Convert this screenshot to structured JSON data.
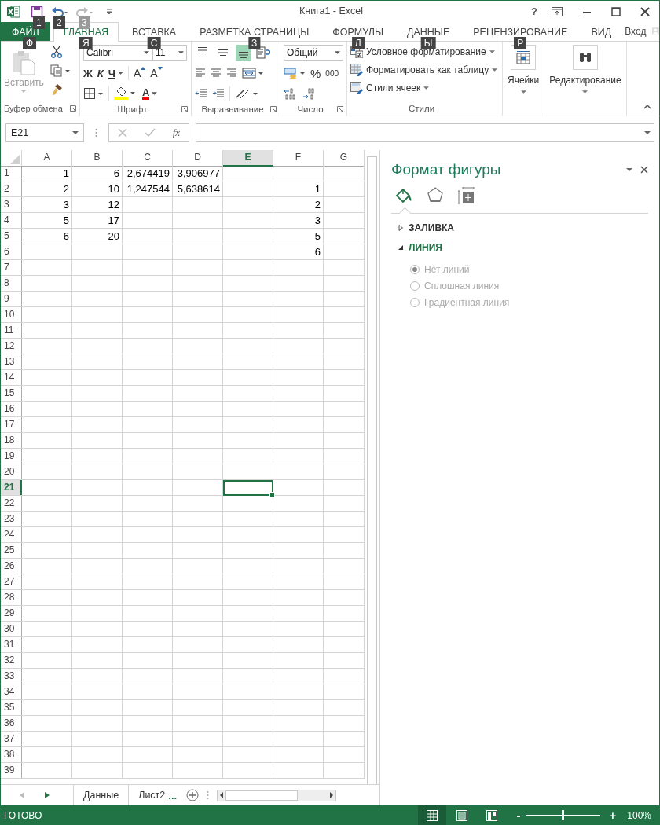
{
  "title_bar": {
    "title": "Книга1 - Excel",
    "help": "?",
    "quick_access": [
      {
        "kind": "save",
        "key_tip": "1",
        "disabled": false
      },
      {
        "kind": "undo",
        "key_tip": "2",
        "disabled": false
      },
      {
        "kind": "redo",
        "key_tip": "3",
        "disabled": true
      }
    ]
  },
  "tabs": [
    {
      "label": "ФАЙЛ",
      "kind": "file",
      "key_tip": "Ф",
      "selected": false
    },
    {
      "label": "ГЛАВНАЯ",
      "kind": "tab",
      "key_tip": "Я",
      "selected": true
    },
    {
      "label": "ВСТАВКА",
      "kind": "tab",
      "key_tip": "С",
      "selected": false
    },
    {
      "label": "РАЗМЕТКА СТРАНИЦЫ",
      "kind": "tab",
      "key_tip": "З",
      "selected": false
    },
    {
      "label": "ФОРМУЛЫ",
      "kind": "tab",
      "key_tip": "Л",
      "selected": false
    },
    {
      "label": "ДАННЫЕ",
      "kind": "tab",
      "key_tip": "Ы",
      "selected": false
    },
    {
      "label": "РЕЦЕНЗИРОВАНИЕ",
      "kind": "tab",
      "key_tip": "Р",
      "selected": false
    },
    {
      "label": "ВИД",
      "kind": "tab",
      "selected": false
    }
  ],
  "account": {
    "label": "Вход"
  },
  "ribbon": {
    "clipboard": {
      "label": "Буфер обмена",
      "paste": "Вставить",
      "paste_disabled": true
    },
    "font": {
      "label": "Шрифт",
      "name": "Calibri",
      "size": "11",
      "bold": "Ж",
      "italic": "К",
      "underline": "Ч",
      "grow": "A",
      "shrink": "A",
      "color_glyph": "A"
    },
    "alignment": {
      "label": "Выравнивание",
      "vertical": [
        {
          "selected": false
        },
        {
          "selected": false
        },
        {
          "selected": true
        }
      ]
    },
    "number": {
      "label": "Число",
      "format": "Общий",
      "percent": "%",
      "thousands": "000"
    },
    "styles": {
      "label": "Стили",
      "items": [
        {
          "kind": "conditional",
          "label": "Условное форматирование"
        },
        {
          "kind": "table",
          "label": "Форматировать как таблицу"
        },
        {
          "kind": "cell",
          "label": "Стили ячеек"
        }
      ]
    },
    "cells": {
      "label": "Ячейки"
    },
    "editing": {
      "label": "Редактирование"
    }
  },
  "formula_bar": {
    "name_box": "E21",
    "function_label": "fx"
  },
  "sheet": {
    "columns": [
      {
        "label": "A",
        "selected": false
      },
      {
        "label": "B",
        "selected": false
      },
      {
        "label": "C",
        "selected": false
      },
      {
        "label": "D",
        "selected": false
      },
      {
        "label": "E",
        "selected": true
      },
      {
        "label": "F",
        "selected": false
      },
      {
        "label": "G",
        "selected": false
      }
    ],
    "rows": [
      {
        "label": "1",
        "selected": false,
        "cells": [
          "1",
          "6",
          "2,674419",
          "3,906977",
          null,
          null,
          null
        ]
      },
      {
        "label": "2",
        "selected": false,
        "cells": [
          "2",
          "10",
          "1,247544",
          "5,638614",
          null,
          "1",
          null
        ]
      },
      {
        "label": "3",
        "selected": false,
        "cells": [
          "3",
          "12",
          null,
          null,
          null,
          "2",
          null
        ]
      },
      {
        "label": "4",
        "selected": false,
        "cells": [
          "5",
          "17",
          null,
          null,
          null,
          "3",
          null
        ]
      },
      {
        "label": "5",
        "selected": false,
        "cells": [
          "6",
          "20",
          null,
          null,
          null,
          "5",
          null
        ]
      },
      {
        "label": "6",
        "selected": false,
        "cells": [
          null,
          null,
          null,
          null,
          null,
          "6",
          null
        ]
      },
      {
        "label": "7",
        "selected": false
      },
      {
        "label": "8",
        "selected": false
      },
      {
        "label": "9",
        "selected": false
      },
      {
        "label": "10",
        "selected": false
      },
      {
        "label": "11",
        "selected": false
      },
      {
        "label": "12",
        "selected": false
      },
      {
        "label": "13",
        "selected": false
      },
      {
        "label": "14",
        "selected": false
      },
      {
        "label": "15",
        "selected": false
      },
      {
        "label": "16",
        "selected": false
      },
      {
        "label": "17",
        "selected": false
      },
      {
        "label": "18",
        "selected": false
      },
      {
        "label": "19",
        "selected": false
      },
      {
        "label": "20",
        "selected": false
      },
      {
        "label": "21",
        "selected": true
      },
      {
        "label": "22",
        "selected": false
      },
      {
        "label": "23",
        "selected": false
      },
      {
        "label": "24",
        "selected": false
      },
      {
        "label": "25",
        "selected": false
      },
      {
        "label": "26",
        "selected": false
      },
      {
        "label": "27",
        "selected": false
      },
      {
        "label": "28",
        "selected": false
      },
      {
        "label": "29",
        "selected": false
      },
      {
        "label": "30",
        "selected": false
      },
      {
        "label": "31",
        "selected": false
      },
      {
        "label": "32",
        "selected": false
      },
      {
        "label": "33",
        "selected": false
      },
      {
        "label": "34",
        "selected": false
      },
      {
        "label": "35",
        "selected": false
      },
      {
        "label": "36",
        "selected": false
      },
      {
        "label": "37",
        "selected": false
      },
      {
        "label": "38",
        "selected": false
      },
      {
        "label": "39",
        "selected": false
      }
    ]
  },
  "pane": {
    "title": "Формат фигуры",
    "tabs": [
      {
        "kind": "fill",
        "selected": true
      },
      {
        "kind": "effects",
        "selected": false
      },
      {
        "kind": "size",
        "selected": false
      }
    ],
    "sections": [
      {
        "label": "ЗАЛИВКА",
        "expanded": false
      },
      {
        "label": "ЛИНИЯ",
        "expanded": true,
        "options": [
          {
            "label": "Нет линий",
            "selected": true,
            "disabled": true
          },
          {
            "label": "Сплошная линия",
            "selected": false,
            "disabled": true
          },
          {
            "label": "Градиентная линия",
            "selected": false,
            "disabled": true
          }
        ]
      }
    ]
  },
  "sheet_tabs": {
    "tabs": [
      {
        "label": "Данные",
        "selected": false
      },
      {
        "label": "Лист2",
        "selected": false
      }
    ],
    "more": "..."
  },
  "status_bar": {
    "status": "ГОТОВО",
    "views": [
      {
        "kind": "normal",
        "selected": true
      },
      {
        "kind": "layout",
        "selected": false
      },
      {
        "kind": "break",
        "selected": false
      }
    ],
    "zoom": {
      "minus": "-",
      "plus": "+",
      "level": 0.5,
      "reading": "100%"
    }
  }
}
